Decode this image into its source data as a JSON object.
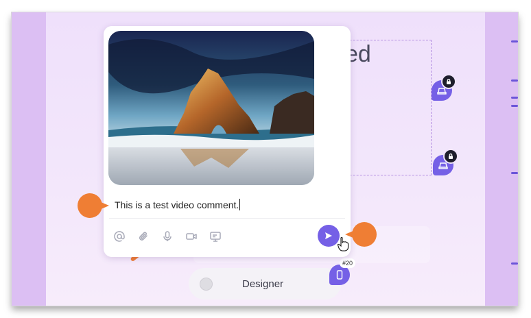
{
  "background": {
    "heading_fragment": "ed"
  },
  "comment": {
    "text": "This is a test video comment.",
    "media_alt": "beach-rock-arch-photo"
  },
  "toolbar": {
    "icons": [
      "at-icon",
      "paperclip-icon",
      "microphone-icon",
      "video-camera-icon",
      "screen-share-icon"
    ]
  },
  "send": {
    "icon": "send-icon"
  },
  "pins": {
    "count_badge": "#20"
  },
  "options": {
    "designer_label": "Designer"
  },
  "colors": {
    "accent": "#7560e6",
    "marker": "#ef7e34",
    "background": "#efe0fb",
    "sidebar": "#dcbff3"
  }
}
